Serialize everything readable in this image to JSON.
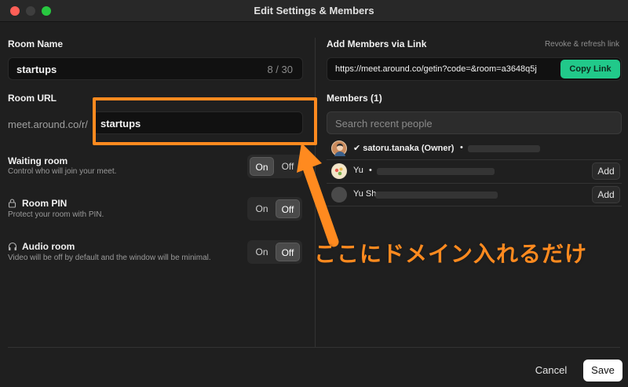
{
  "window": {
    "title": "Edit Settings & Members"
  },
  "room_name": {
    "label": "Room Name",
    "value": "startups",
    "count": "8 / 30"
  },
  "room_url": {
    "label": "Room URL",
    "prefix": "meet.around.co/r/",
    "value": "startups"
  },
  "waiting_room": {
    "label": "Waiting room",
    "description": "Control who will join your meet.",
    "on": "On",
    "off": "Off",
    "state": "on"
  },
  "room_pin": {
    "label": "Room PIN",
    "description": "Protect your room with PIN.",
    "on": "On",
    "off": "Off",
    "state": "off"
  },
  "audio_room": {
    "label": "Audio room",
    "description": "Video will be off by default and the window will be minimal.",
    "on": "On",
    "off": "Off",
    "state": "off"
  },
  "link": {
    "label": "Add Members via Link",
    "revoke": "Revoke & refresh link",
    "url": "https://meet.around.co/getin?code=&room=a3648q5j",
    "copy": "Copy Link"
  },
  "members": {
    "label": "Members (1)",
    "search_placeholder": "Search recent people",
    "list": [
      {
        "name": "✔ satoru.tanaka (Owner)",
        "dot": "•"
      },
      {
        "name": "Yu",
        "dot": "•",
        "action": "Add"
      },
      {
        "name": "Yu Sh",
        "action": "Add"
      }
    ]
  },
  "footer": {
    "cancel": "Cancel",
    "save": "Save"
  },
  "annotation": {
    "text": "ここにドメイン入れるだけ",
    "color": "#ff8a1f"
  },
  "colors": {
    "accent": "#21c98a",
    "highlight": "#ff8a1f"
  }
}
